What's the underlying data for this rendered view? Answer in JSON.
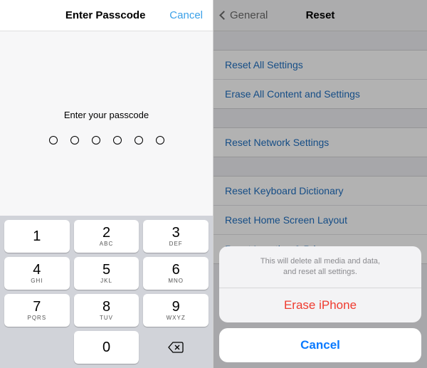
{
  "left": {
    "nav": {
      "title": "Enter Passcode",
      "cancel": "Cancel"
    },
    "prompt": "Enter your passcode",
    "keypad": {
      "r1": [
        {
          "d": "1",
          "l": ""
        },
        {
          "d": "2",
          "l": "ABC"
        },
        {
          "d": "3",
          "l": "DEF"
        }
      ],
      "r2": [
        {
          "d": "4",
          "l": "GHI"
        },
        {
          "d": "5",
          "l": "JKL"
        },
        {
          "d": "6",
          "l": "MNO"
        }
      ],
      "r3": [
        {
          "d": "7",
          "l": "PQRS"
        },
        {
          "d": "8",
          "l": "TUV"
        },
        {
          "d": "9",
          "l": "WXYZ"
        }
      ],
      "zero": "0"
    }
  },
  "right": {
    "nav": {
      "back": "General",
      "title": "Reset"
    },
    "sections": {
      "g1": [
        "Reset All Settings",
        "Erase All Content and Settings"
      ],
      "g2": [
        "Reset Network Settings"
      ],
      "g3": [
        "Reset Keyboard Dictionary",
        "Reset Home Screen Layout",
        "Reset Location & Privacy"
      ]
    },
    "sheet": {
      "msg1": "This will delete all media and data,",
      "msg2": "and reset all settings.",
      "erase": "Erase iPhone",
      "cancel": "Cancel"
    }
  }
}
